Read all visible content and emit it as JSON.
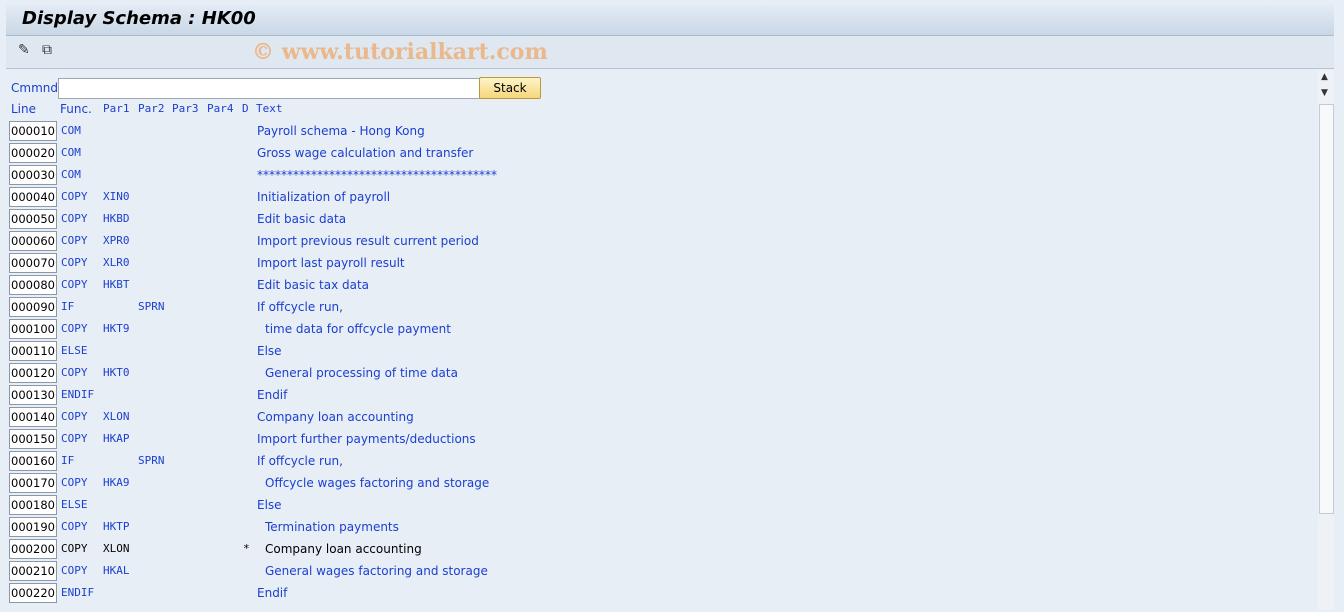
{
  "window": {
    "title": "Display Schema : HK00"
  },
  "toolbar": {
    "icons": [
      "display-change-icon",
      "other-object-icon"
    ],
    "watermark": "© www.tutorialkart.com"
  },
  "command": {
    "label": "Cmmnd",
    "value": "",
    "stack_label": "Stack"
  },
  "columns": [
    "Line",
    "Func.",
    "Par1",
    "Par2",
    "Par3",
    "Par4",
    "D",
    "Text"
  ],
  "rows": [
    {
      "line": "000010",
      "func": "COM",
      "par1": "",
      "par2": "",
      "d": "",
      "text": "Payroll schema - Hong Kong",
      "indent": false,
      "inactive": false
    },
    {
      "line": "000020",
      "func": "COM",
      "par1": "",
      "par2": "",
      "d": "",
      "text": "Gross wage calculation and transfer",
      "indent": false,
      "inactive": false
    },
    {
      "line": "000030",
      "func": "COM",
      "par1": "",
      "par2": "",
      "d": "",
      "text": "****************************************",
      "indent": false,
      "inactive": false
    },
    {
      "line": "000040",
      "func": "COPY",
      "par1": "XIN0",
      "par2": "",
      "d": "",
      "text": "Initialization of payroll",
      "indent": false,
      "inactive": false
    },
    {
      "line": "000050",
      "func": "COPY",
      "par1": "HKBD",
      "par2": "",
      "d": "",
      "text": "Edit basic data",
      "indent": false,
      "inactive": false
    },
    {
      "line": "000060",
      "func": "COPY",
      "par1": "XPR0",
      "par2": "",
      "d": "",
      "text": "Import previous result current period",
      "indent": false,
      "inactive": false
    },
    {
      "line": "000070",
      "func": "COPY",
      "par1": "XLR0",
      "par2": "",
      "d": "",
      "text": "Import last payroll result",
      "indent": false,
      "inactive": false
    },
    {
      "line": "000080",
      "func": "COPY",
      "par1": "HKBT",
      "par2": "",
      "d": "",
      "text": "Edit basic tax data",
      "indent": false,
      "inactive": false
    },
    {
      "line": "000090",
      "func": "IF",
      "par1": "",
      "par2": "SPRN",
      "d": "",
      "text": "If offcycle run,",
      "indent": false,
      "inactive": false
    },
    {
      "line": "000100",
      "func": "COPY",
      "par1": "HKT9",
      "par2": "",
      "d": "",
      "text": "time data for offcycle payment",
      "indent": true,
      "inactive": false
    },
    {
      "line": "000110",
      "func": "ELSE",
      "par1": "",
      "par2": "",
      "d": "",
      "text": "Else",
      "indent": false,
      "inactive": false
    },
    {
      "line": "000120",
      "func": "COPY",
      "par1": "HKT0",
      "par2": "",
      "d": "",
      "text": "General processing of time data",
      "indent": true,
      "inactive": false
    },
    {
      "line": "000130",
      "func": "ENDIF",
      "par1": "",
      "par2": "",
      "d": "",
      "text": "Endif",
      "indent": false,
      "inactive": false
    },
    {
      "line": "000140",
      "func": "COPY",
      "par1": "XLON",
      "par2": "",
      "d": "",
      "text": "Company loan accounting",
      "indent": false,
      "inactive": false
    },
    {
      "line": "000150",
      "func": "COPY",
      "par1": "HKAP",
      "par2": "",
      "d": "",
      "text": "Import further payments/deductions",
      "indent": false,
      "inactive": false
    },
    {
      "line": "000160",
      "func": "IF",
      "par1": "",
      "par2": "SPRN",
      "d": "",
      "text": "If offcycle run,",
      "indent": false,
      "inactive": false
    },
    {
      "line": "000170",
      "func": "COPY",
      "par1": "HKA9",
      "par2": "",
      "d": "",
      "text": "Offcycle wages factoring and storage",
      "indent": true,
      "inactive": false
    },
    {
      "line": "000180",
      "func": "ELSE",
      "par1": "",
      "par2": "",
      "d": "",
      "text": "Else",
      "indent": false,
      "inactive": false
    },
    {
      "line": "000190",
      "func": "COPY",
      "par1": "HKTP",
      "par2": "",
      "d": "",
      "text": "Termination payments",
      "indent": true,
      "inactive": false
    },
    {
      "line": "000200",
      "func": "COPY",
      "par1": "XLON",
      "par2": "",
      "d": "*",
      "text": "Company loan accounting",
      "indent": true,
      "inactive": true
    },
    {
      "line": "000210",
      "func": "COPY",
      "par1": "HKAL",
      "par2": "",
      "d": "",
      "text": "General wages factoring and storage",
      "indent": true,
      "inactive": false
    },
    {
      "line": "000220",
      "func": "ENDIF",
      "par1": "",
      "par2": "",
      "d": "",
      "text": "Endif",
      "indent": false,
      "inactive": false
    }
  ],
  "colors": {
    "text": "#1a3fd0",
    "inactive": "#000000",
    "stack_button": "#f5d77b"
  }
}
